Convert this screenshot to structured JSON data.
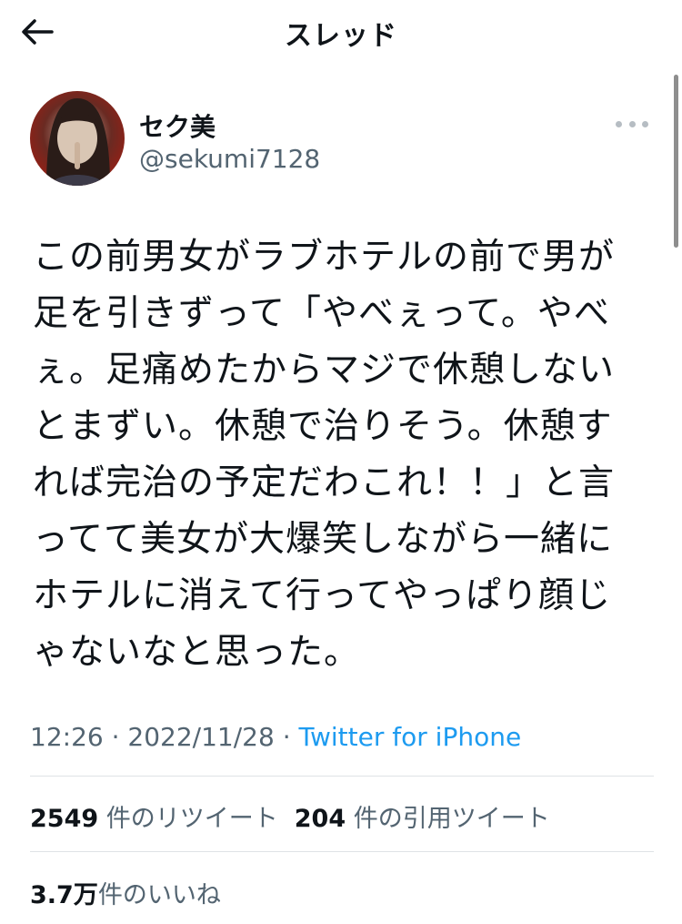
{
  "header": {
    "title": "スレッド",
    "back_icon": "arrow-left-icon"
  },
  "tweet": {
    "author_name": "セク美",
    "author_handle": "@sekumi7128",
    "text": "この前男女がラブホテルの前で男が\n足を引きずって「やべぇって。やべ\nぇ。足痛めたからマジで休憩しない\nとまずい。休憩で治りそう。休憩す\nれば完治の予定だわこれ！！」と言\nってて美女が大爆笑しながら一緒に\nホテルに消えて行ってやっぱり顔じ\nゃないなと思った。",
    "time": "12:26",
    "date": "2022/11/28",
    "separator": "·",
    "source": "Twitter for iPhone"
  },
  "stats": {
    "retweets_count": "2549",
    "retweets_label": "件のリツイート",
    "quotes_count": "204",
    "quotes_label": "件の引用ツイート",
    "likes_count": "3.7万",
    "likes_label": "件のいいね"
  },
  "colors": {
    "text": "#0f1419",
    "secondary": "#536471",
    "link": "#1d9bf0",
    "divider": "#dfe3e6"
  }
}
